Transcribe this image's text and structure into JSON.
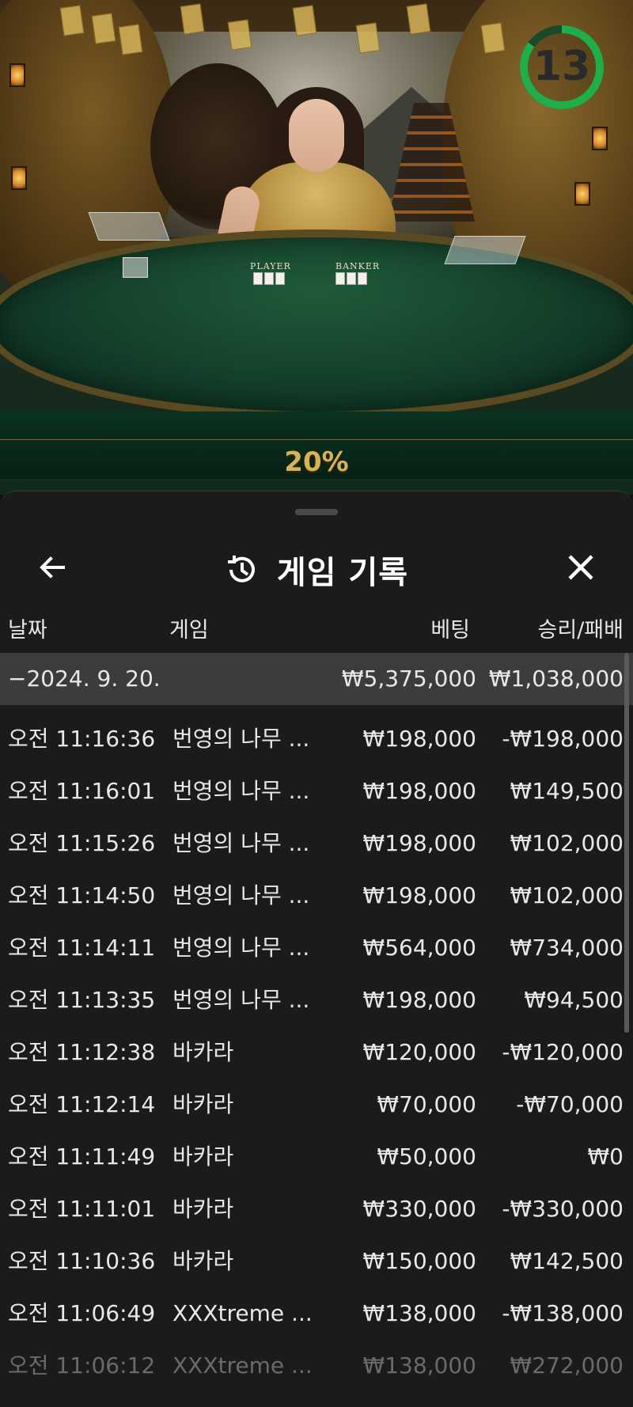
{
  "video": {
    "payout_percent": "20%",
    "timer_value": "13",
    "timer_fraction": 0.85,
    "table_labels": [
      "PLAYER",
      "BANKER"
    ]
  },
  "panel": {
    "title": "게임 기록",
    "title_icon": "history-icon",
    "back_icon": "arrow-left-icon",
    "close_icon": "close-icon"
  },
  "columns": {
    "date": "날짜",
    "game": "게임",
    "bet": "베팅",
    "result": "승리/패배"
  },
  "summary": {
    "date": "−2024. 9. 20.",
    "bet": "₩5,375,000",
    "result": "₩1,038,000"
  },
  "rows": [
    {
      "time": "오전 11:16:36",
      "game": "번영의 나무 ...",
      "bet": "₩198,000",
      "result": "-₩198,000"
    },
    {
      "time": "오전 11:16:01",
      "game": "번영의 나무 ...",
      "bet": "₩198,000",
      "result": "₩149,500"
    },
    {
      "time": "오전 11:15:26",
      "game": "번영의 나무 ...",
      "bet": "₩198,000",
      "result": "₩102,000"
    },
    {
      "time": "오전 11:14:50",
      "game": "번영의 나무 ...",
      "bet": "₩198,000",
      "result": "₩102,000"
    },
    {
      "time": "오전 11:14:11",
      "game": "번영의 나무 ...",
      "bet": "₩564,000",
      "result": "₩734,000"
    },
    {
      "time": "오전 11:13:35",
      "game": "번영의 나무 ...",
      "bet": "₩198,000",
      "result": "₩94,500"
    },
    {
      "time": "오전 11:12:38",
      "game": "바카라",
      "bet": "₩120,000",
      "result": "-₩120,000"
    },
    {
      "time": "오전 11:12:14",
      "game": "바카라",
      "bet": "₩70,000",
      "result": "-₩70,000"
    },
    {
      "time": "오전 11:11:49",
      "game": "바카라",
      "bet": "₩50,000",
      "result": "₩0"
    },
    {
      "time": "오전 11:11:01",
      "game": "바카라",
      "bet": "₩330,000",
      "result": "-₩330,000"
    },
    {
      "time": "오전 11:10:36",
      "game": "바카라",
      "bet": "₩150,000",
      "result": "₩142,500"
    },
    {
      "time": "오전 11:06:49",
      "game": "XXXtreme ...",
      "bet": "₩138,000",
      "result": "-₩138,000"
    },
    {
      "time": "오전 11:06:12",
      "game": "XXXtreme ...",
      "bet": "₩138,000",
      "result": "₩272,000"
    }
  ],
  "colors": {
    "panel_bg": "#1b1b1b",
    "summary_bg": "#3c3c3c",
    "timer_green": "#1fae4a",
    "payout_gold": "#d8b25a"
  }
}
